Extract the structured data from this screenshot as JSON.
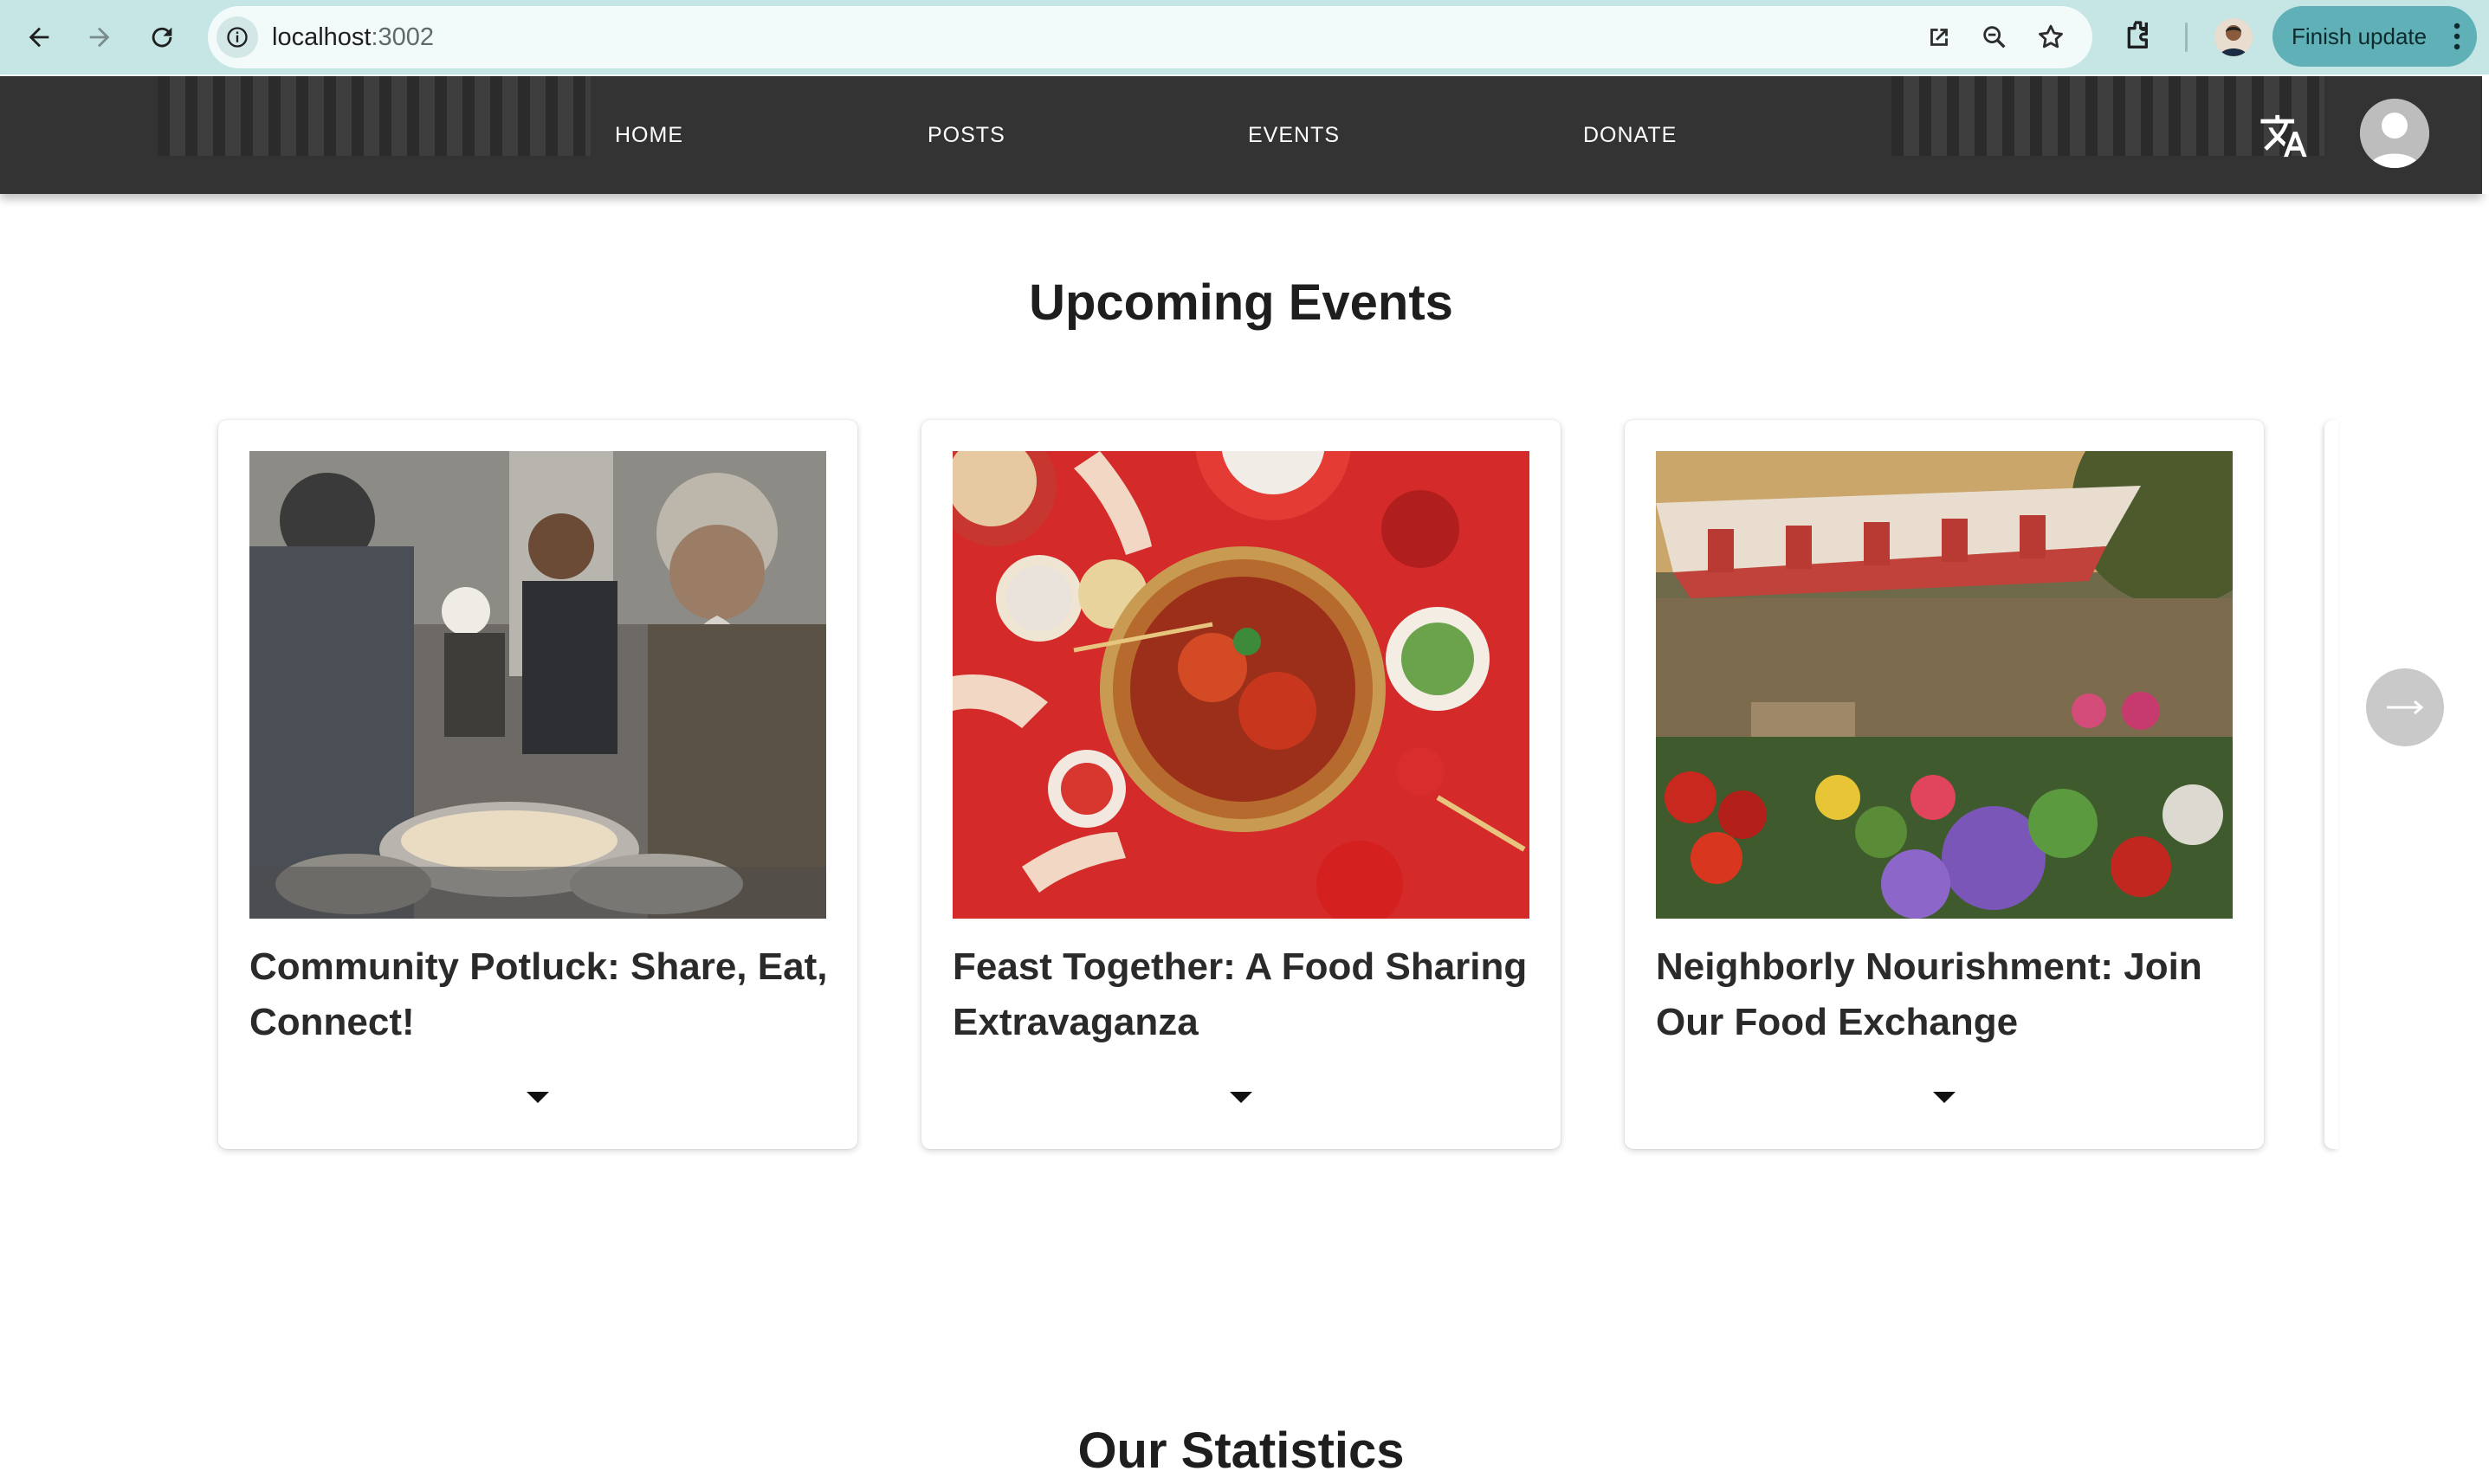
{
  "browser": {
    "url_host": "localhost",
    "url_port": ":3002",
    "finish_update_label": "Finish update",
    "icons": [
      "back-arrow-icon",
      "forward-arrow-icon",
      "reload-icon",
      "info-icon",
      "open-external-icon",
      "zoom-icon",
      "bookmark-star-icon",
      "extensions-icon",
      "more-vert-icon"
    ]
  },
  "header": {
    "menu": [
      {
        "label": "HOME"
      },
      {
        "label": "POSTS"
      },
      {
        "label": "EVENTS"
      },
      {
        "label": "DONATE"
      }
    ],
    "icons": [
      "translate-icon",
      "user-avatar"
    ]
  },
  "events": {
    "title": "Upcoming Events",
    "cards": [
      {
        "title": "Community Potluck: Share, Eat, Connect!",
        "image": "people serving food at a community buffet"
      },
      {
        "title": "Feast Together: A Food Sharing Extravaganza",
        "image": "hands with chopsticks around a hot pot on a red table"
      },
      {
        "title": "Neighborly Nourishment: Join Our Food Exchange",
        "image": "farmers market produce stall under a striped awning"
      }
    ]
  },
  "statistics": {
    "title": "Our Statistics"
  },
  "colors": {
    "chrome_bg": "#c6e6e6",
    "header_bg": "#333333",
    "finish_button": "#5fb0b7",
    "next_button": "#c9c9c9"
  }
}
